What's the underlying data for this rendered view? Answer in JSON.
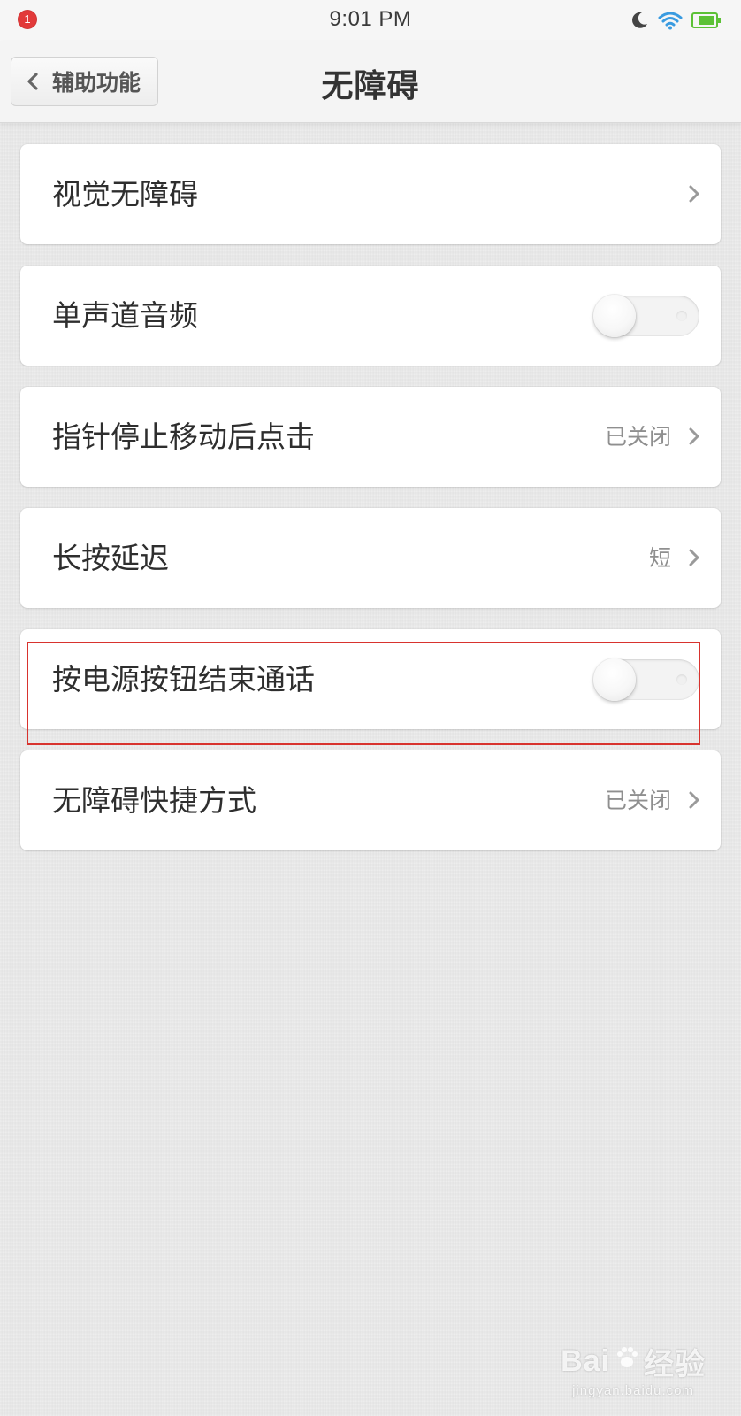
{
  "status_bar": {
    "notification_count": "1",
    "time": "9:01 PM",
    "icons": [
      "moon-icon",
      "wifi-icon",
      "battery-icon"
    ],
    "colors": {
      "badge": "#e23a3a",
      "wifi": "#3a9be0",
      "battery": "#5cc136"
    }
  },
  "nav": {
    "back_label": "辅助功能",
    "title": "无障碍"
  },
  "settings": [
    {
      "label": "视觉无障碍",
      "value": "",
      "control": "chevron"
    },
    {
      "label": "单声道音频",
      "value": "",
      "control": "toggle",
      "on": false
    },
    {
      "label": "指针停止移动后点击",
      "value": "已关闭",
      "control": "chevron"
    },
    {
      "label": "长按延迟",
      "value": "短",
      "control": "chevron"
    },
    {
      "label": "按电源按钮结束通话",
      "value": "",
      "control": "toggle",
      "on": false,
      "highlighted": true
    },
    {
      "label": "无障碍快捷方式",
      "value": "已关闭",
      "control": "chevron"
    }
  ],
  "highlight_color": "#d8332e",
  "watermark": {
    "logo_text": "Bai",
    "logo_suffix": "经验",
    "url": "jingyan.baidu.com"
  }
}
